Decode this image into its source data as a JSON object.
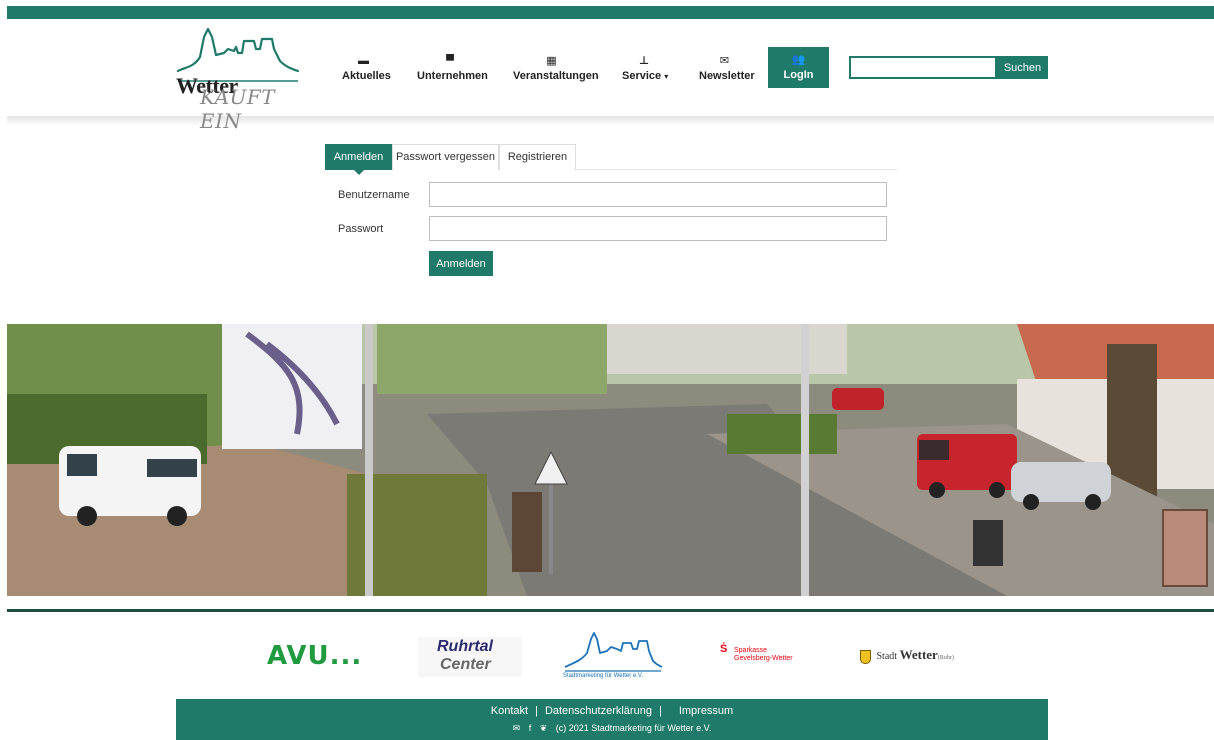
{
  "brand": {
    "logo_word": "Wetter",
    "logo_sub": "KAUFT EIN",
    "primary_color": "#1f7a6a"
  },
  "nav": {
    "items": [
      {
        "label": "Aktuelles",
        "icon": "newspaper-icon"
      },
      {
        "label": "Unternehmen",
        "icon": "store-icon"
      },
      {
        "label": "Veranstaltungen",
        "icon": "calendar-icon"
      },
      {
        "label": "Service",
        "icon": "sitemap-icon",
        "dropdown": "▾"
      },
      {
        "label": "Newsletter",
        "icon": "envelope-open-icon"
      }
    ],
    "login": {
      "label": "LogIn",
      "icon": "users-icon"
    }
  },
  "search": {
    "value": "",
    "button_label": "Suchen"
  },
  "login_form": {
    "tabs": [
      {
        "label": "Anmelden",
        "active": true
      },
      {
        "label": "Passwort vergessen",
        "active": false
      },
      {
        "label": "Registrieren",
        "active": false
      }
    ],
    "username_label": "Benutzername",
    "username_value": "",
    "password_label": "Passwort",
    "password_value": "",
    "submit_label": "Anmelden"
  },
  "sponsors": {
    "avu": "AVU...",
    "ruhrtal_line1": "Ruhrtal",
    "ruhrtal_line2": "Center",
    "stadtmarketing": "Stadtmarketing für Wetter e.V.",
    "sparkasse_line1": "Sparkasse",
    "sparkasse_line2": "Gevelsberg-Wetter",
    "stadt_prefix": "Stadt",
    "stadt_name": "Wetter",
    "stadt_suffix": "(Ruhr)"
  },
  "footer": {
    "links": [
      "Kontakt",
      "Datenschutzerklärung",
      "Impressum"
    ],
    "separator": "|",
    "copyright": "(c) 2021 Stadtmarketing für Wetter e.V."
  }
}
